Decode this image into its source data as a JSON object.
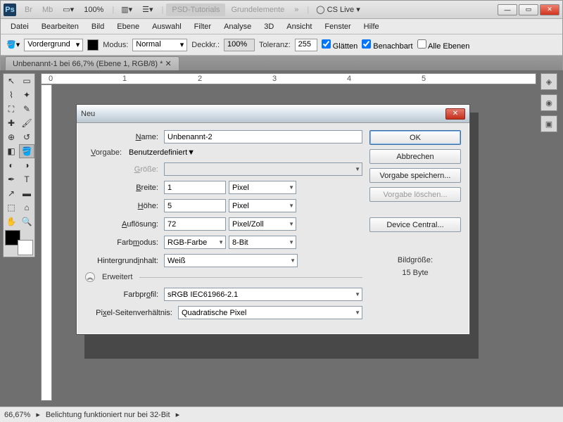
{
  "top": {
    "br": "Br",
    "mb": "Mb",
    "zoom": "100%",
    "psd": "PSD-Tutorials",
    "grund": "Grundelemente",
    "more": "»",
    "cs": "CS Live"
  },
  "menu": [
    "Datei",
    "Bearbeiten",
    "Bild",
    "Ebene",
    "Auswahl",
    "Filter",
    "Analyse",
    "3D",
    "Ansicht",
    "Fenster",
    "Hilfe"
  ],
  "opt": {
    "vg": "Vordergrund",
    "modus": "Modus:",
    "modus_v": "Normal",
    "deck": "Deckkr.:",
    "deck_v": "100%",
    "tol": "Toleranz:",
    "tol_v": "255",
    "gl": "Glätten",
    "ben": "Benachbart",
    "alle": "Alle Ebenen"
  },
  "tab": "Unbenannt-1 bei 66,7% (Ebene 1, RGB/8) *",
  "status": {
    "zoom": "66,67%",
    "msg": "Belichtung funktioniert nur bei 32-Bit"
  },
  "dlg": {
    "title": "Neu",
    "name_l": "Name:",
    "name_v": "Unbenannt-2",
    "preset_l": "Vorgabe:",
    "preset_v": "Benutzerdefiniert",
    "size_l": "Größe:",
    "w_l": "Breite:",
    "w_v": "1",
    "w_u": "Pixel",
    "h_l": "Höhe:",
    "h_v": "5",
    "h_u": "Pixel",
    "res_l": "Auflösung:",
    "res_v": "72",
    "res_u": "Pixel/Zoll",
    "cm_l": "Farbmodus:",
    "cm_v": "RGB-Farbe",
    "cm_b": "8-Bit",
    "bg_l": "Hintergrundinhalt:",
    "bg_v": "Weiß",
    "adv": "Erweitert",
    "prof_l": "Farbprofil:",
    "prof_v": "sRGB IEC61966-2.1",
    "par_l": "Pixel-Seitenverhältnis:",
    "par_v": "Quadratische Pixel",
    "ok": "OK",
    "cancel": "Abbrechen",
    "save": "Vorgabe speichern...",
    "del": "Vorgabe löschen...",
    "dc": "Device Central...",
    "size_t": "Bildgröße:",
    "size_v": "15 Byte"
  },
  "ruler": [
    "0",
    "1",
    "2",
    "3",
    "4",
    "5"
  ]
}
